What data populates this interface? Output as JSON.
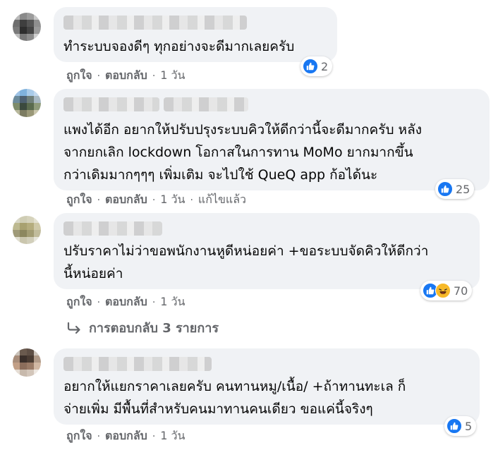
{
  "colors": {
    "bubble": "#f0f2f5",
    "muted": "#65676b",
    "like": "#1877f2",
    "haha": "#f7b928"
  },
  "comments": [
    {
      "text": "ทำระบบจองดีๆ ทุกอย่างจะดีมากเลยครับ",
      "reactions": [
        "like-icon"
      ],
      "reaction_count": "2",
      "actions": {
        "like": "ถูกใจ",
        "reply": "ตอบกลับ",
        "time": "1 วัน"
      }
    },
    {
      "text": "แพงได้อีก อยากให้ปรับปรุงระบบคิวให้ดีกว่านี้จะดีมากครับ หลัง\nจากยกเลิก lockdown โอกาสในการทาน MoMo ยากมากขึ้น\nกว่าเดิมมากๆๆๆ เพิ่มเติม จะไปใช้ QueQ app ก้อได้นะ",
      "reactions": [
        "like-icon"
      ],
      "reaction_count": "25",
      "actions": {
        "like": "ถูกใจ",
        "reply": "ตอบกลับ",
        "time": "1 วัน",
        "edited": "แก้ไขแล้ว"
      }
    },
    {
      "text": "ปรับราคาไม่ว่าขอพนักงานหูดีหน่อยค่า +ขอระบบจัดคิวให้ดีกว่า\nนี้หน่อยค่า",
      "reactions": [
        "like-icon",
        "haha-icon"
      ],
      "reaction_count": "70",
      "actions": {
        "like": "ถูกใจ",
        "reply": "ตอบกลับ",
        "time": "1 วัน"
      },
      "replies_link": "การตอบกลับ 3 รายการ"
    },
    {
      "text": "อยากให้แยกราคาเลยครับ คนทานหมู/เนื้อ/ +ถ้าทานทะเล ก็\nจ่ายเพิ่ม มีพื้นที่สำหรับคนมาทานคนเดียว ขอแค่นี้จริงๆ",
      "reactions": [
        "like-icon"
      ],
      "reaction_count": "5",
      "actions": {
        "like": "ถูกใจ",
        "reply": "ตอบกลับ",
        "time": "1 วัน"
      }
    }
  ]
}
